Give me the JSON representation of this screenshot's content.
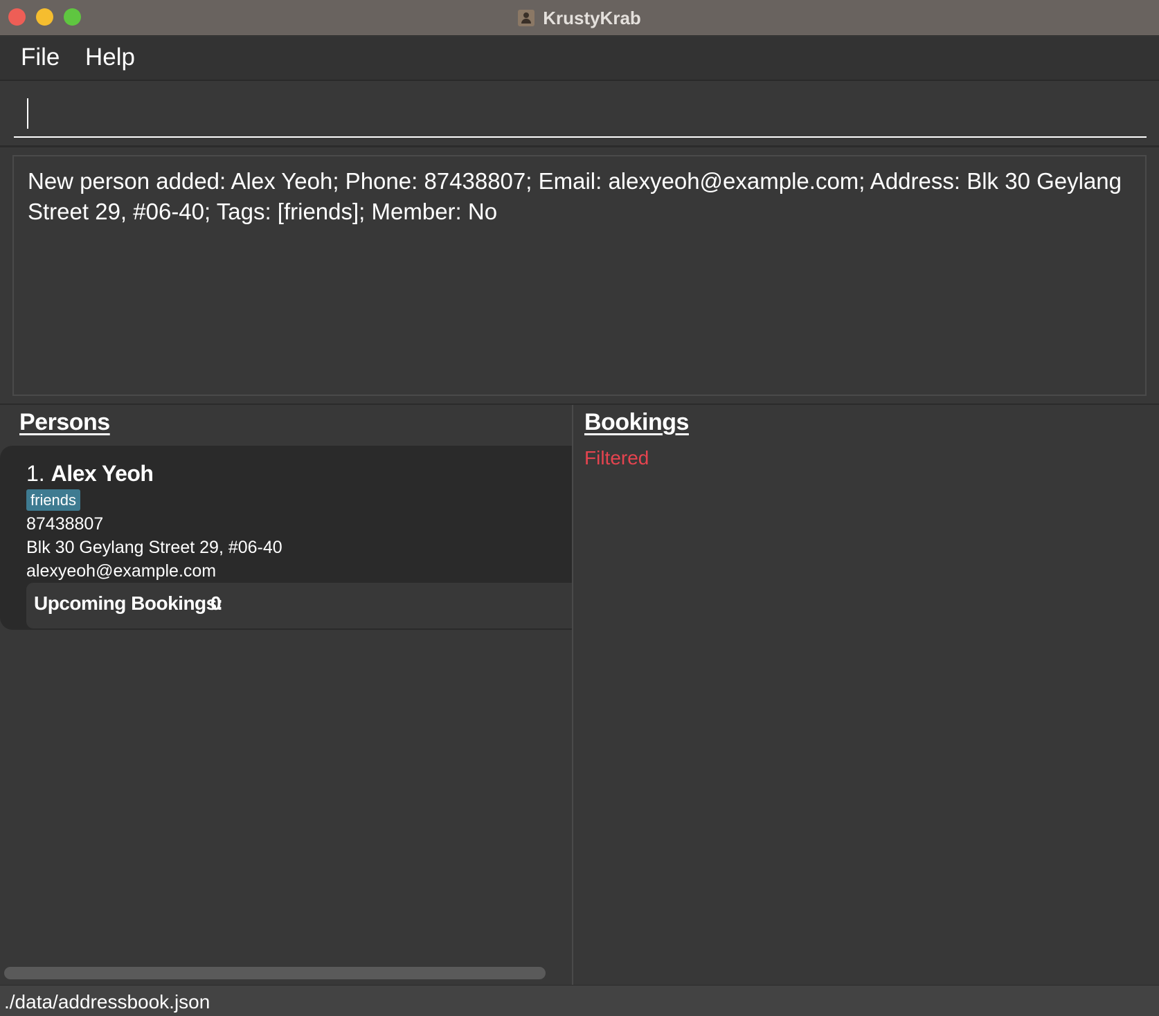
{
  "window": {
    "title": "KrustyKrab"
  },
  "menu": {
    "file": "File",
    "help": "Help"
  },
  "command": {
    "value": "",
    "placeholder": ""
  },
  "result": {
    "message": "New person added: Alex Yeoh; Phone: 87438807; Email: alexyeoh@example.com; Address: Blk 30 Geylang Street 29, #06-40; Tags: [friends]; Member: No"
  },
  "persons": {
    "header": "Persons",
    "items": [
      {
        "index": "1. ",
        "name": "Alex Yeoh",
        "tags": [
          "friends"
        ],
        "phone": "87438807",
        "address": "Blk 30 Geylang Street 29, #06-40",
        "email": "alexyeoh@example.com",
        "upcoming_label": "Upcoming Bookings:",
        "upcoming_count": "0"
      }
    ]
  },
  "bookings": {
    "header": "Bookings",
    "status": "Filtered"
  },
  "status_bar": {
    "path": "./data/addressbook.json"
  },
  "colors": {
    "background": "#383838",
    "title_bar": "#69635f",
    "card": "#2a2a2a",
    "tag": "#3e7b91",
    "filtered_text": "#e5444f",
    "close": "#ee5e56",
    "minimize": "#f5bd2f",
    "maximize": "#5fc640"
  },
  "icons": {
    "app": "contact-book-icon"
  }
}
